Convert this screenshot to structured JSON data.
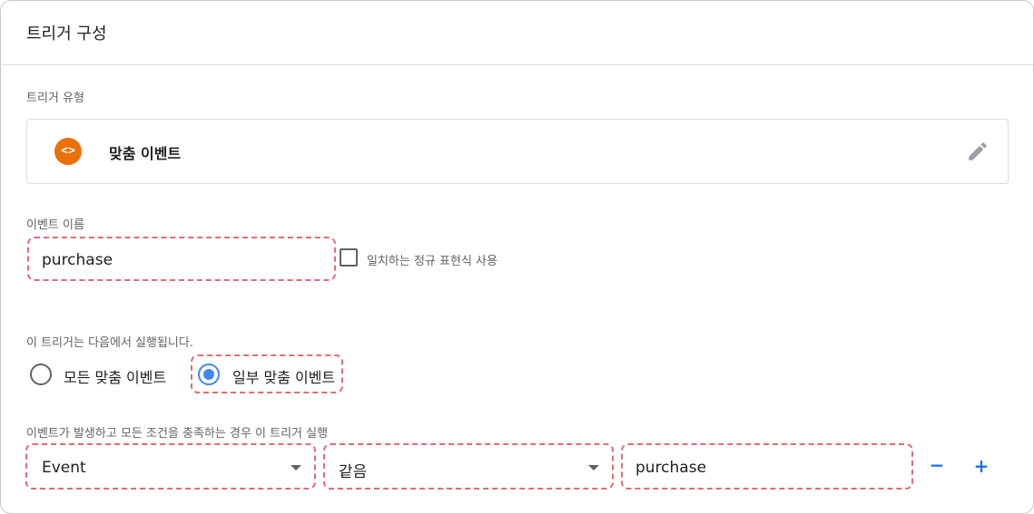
{
  "header": {
    "title": "트리거 구성"
  },
  "trigger_type": {
    "label": "트리거 유형",
    "name": "맞춤 이벤트",
    "icon": "code-icon",
    "icon_glyph": "<>",
    "icon_color": "#e8710a"
  },
  "event_name": {
    "label": "이벤트 이름",
    "value": "purchase",
    "regex_checkbox_label": "일치하는 정규 표현식 사용",
    "regex_checked": false
  },
  "fires_on": {
    "label": "이 트리거는 다음에서 실행됩니다.",
    "options": [
      "모든 맞춤 이벤트",
      "일부 맞춤 이벤트"
    ],
    "selected": "일부 맞춤 이벤트"
  },
  "condition": {
    "label": "이벤트가 발생하고 모든 조건을 충족하는 경우 이 트리거 실행",
    "variable": "Event",
    "operator": "같음",
    "value": "purchase",
    "remove_label": "−",
    "add_label": "+"
  },
  "colors": {
    "accent": "#1a73e8",
    "radio_selected": "#4285f4",
    "highlight_dashed": "#e06c75"
  }
}
